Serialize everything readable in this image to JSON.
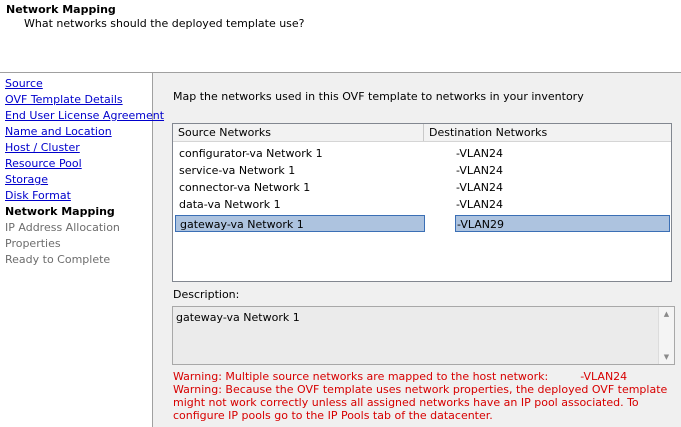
{
  "header": {
    "title": "Network Mapping",
    "subtitle": "What networks should the deployed template use?"
  },
  "sidebar": {
    "items": [
      {
        "label": "Source",
        "state": "link"
      },
      {
        "label": "OVF Template Details",
        "state": "link"
      },
      {
        "label": "End User License Agreement",
        "state": "link"
      },
      {
        "label": "Name and Location",
        "state": "link"
      },
      {
        "label": "Host / Cluster",
        "state": "link"
      },
      {
        "label": "Resource Pool",
        "state": "link"
      },
      {
        "label": "Storage",
        "state": "link"
      },
      {
        "label": "Disk Format",
        "state": "link"
      },
      {
        "label": "Network Mapping",
        "state": "current"
      },
      {
        "label": "IP Address Allocation",
        "state": "disabled"
      },
      {
        "label": "Properties",
        "state": "disabled"
      },
      {
        "label": "Ready to Complete",
        "state": "disabled"
      }
    ]
  },
  "main": {
    "intro": "Map the networks used in this OVF template to networks in your inventory",
    "grid": {
      "headers": {
        "source": "Source Networks",
        "destination": "Destination Networks"
      },
      "rows": [
        {
          "source": "configurator-va Network 1",
          "destination": "-VLAN24",
          "selected": false
        },
        {
          "source": "service-va Network 1",
          "destination": "-VLAN24",
          "selected": false
        },
        {
          "source": "connector-va Network 1",
          "destination": "-VLAN24",
          "selected": false
        },
        {
          "source": "data-va Network 1",
          "destination": "-VLAN24",
          "selected": false
        },
        {
          "source": "gateway-va Network 1",
          "destination": "-VLAN29",
          "selected": true
        }
      ]
    },
    "description": {
      "label": "Description:",
      "text": "gateway-va Network 1"
    },
    "warnings": {
      "line1_prefix": "Warning: Multiple source networks are mapped to the host network:",
      "line1_suffix": "-VLAN24",
      "line2": "Warning: Because the OVF template uses network properties, the deployed OVF template might not work correctly unless all assigned networks have an IP pool associated. To configure IP pools go to the IP Pools tab of the datacenter."
    }
  },
  "colors": {
    "link": "#0000cc",
    "warning": "#d70000",
    "selection": "#adc3df",
    "selection_border": "#3b6fb5"
  }
}
